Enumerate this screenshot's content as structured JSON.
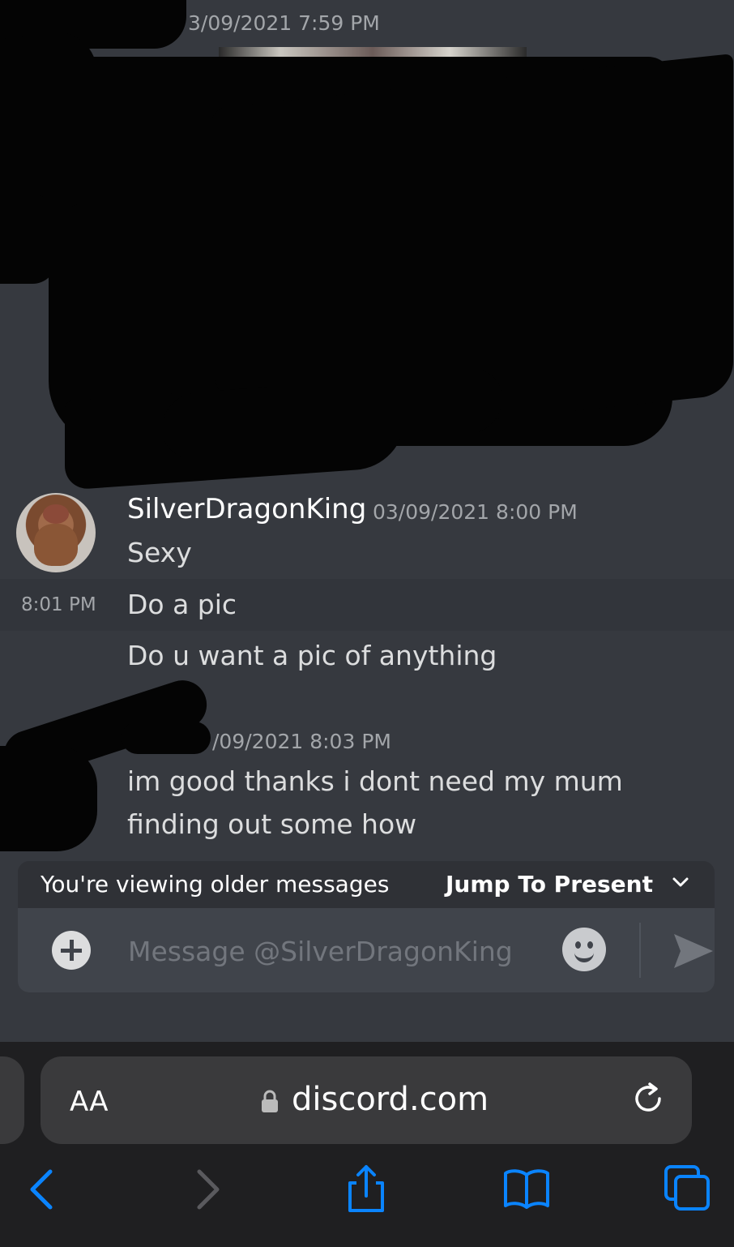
{
  "chat": {
    "top_timestamp": "3/09/2021 7:59 PM",
    "group1": {
      "username": "SilverDragonKing",
      "timestamp": "03/09/2021 8:00 PM",
      "messages": [
        "Sexy",
        "Do a pic",
        "Do u want a pic of anything"
      ],
      "side_time": "8:01 PM"
    },
    "group2": {
      "timestamp": "/09/2021 8:03 PM",
      "messages": [
        "im good thanks i dont need my mum",
        "finding out some how"
      ]
    }
  },
  "older_bar": {
    "text": "You're viewing older messages",
    "jump_label": "Jump To Present"
  },
  "composer": {
    "placeholder": "Message @SilverDragonKing"
  },
  "safari": {
    "aa_label": "AA",
    "url": "discord.com"
  },
  "colors": {
    "background": "#36393f",
    "accent_blue": "#0a84ff"
  }
}
